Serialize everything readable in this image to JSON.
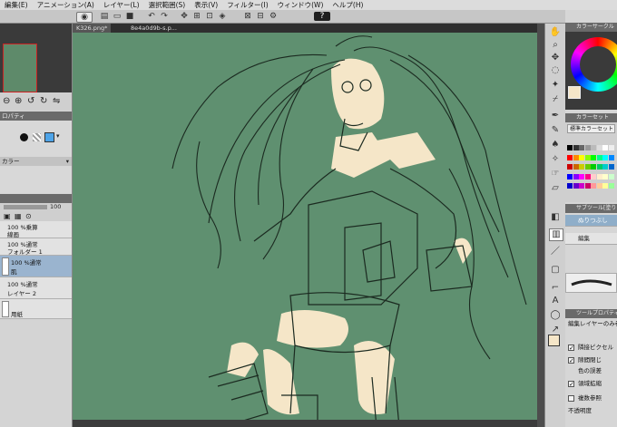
{
  "menu": [
    "編集(E)",
    "アニメーション(A)",
    "レイヤー(L)",
    "選択範囲(S)",
    "表示(V)",
    "フィルター(I)",
    "ウィンドウ(W)",
    "ヘルプ(H)"
  ],
  "doc_tabs": [
    "K326.png*",
    "8e4a0d9b-s.p..."
  ],
  "left": {
    "property_tab": "ロパティ",
    "color_label": "カラー",
    "opacity_value": "100",
    "layers": [
      {
        "label": "100 %乗算",
        "sub": "線画",
        "selected": false
      },
      {
        "label": "100 %通常",
        "sub": "フォルダー 1",
        "selected": false
      },
      {
        "label": "100 %通常",
        "sub": "肌",
        "selected": true
      },
      {
        "label": "100 %通常",
        "sub": "レイヤー 2",
        "selected": false
      },
      {
        "label": "",
        "sub": "用紙",
        "selected": false
      }
    ]
  },
  "right": {
    "color_circle_tab": "カラーサークル",
    "color_set_tab": "カラーセット",
    "standard_color_set": "標準カラーセット",
    "sub_tool_tab": "サブツール[塗り",
    "sub_tools": [
      "ぬりつぶし",
      "編集"
    ],
    "tool_property_tab": "ツールプロパティ",
    "edit_layer_only": "編集レイヤーのみ参",
    "properties": [
      {
        "label": "隣接ピクセル",
        "checked": true
      },
      {
        "label": "隙間閉じ",
        "checked": true
      },
      {
        "label": "色の誤差",
        "checked": false
      },
      {
        "label": "領域拡縮",
        "checked": true
      },
      {
        "label": "複数参照",
        "checked": false
      },
      {
        "label": "不透明度",
        "checked": false
      }
    ]
  },
  "colors": {
    "canvas_bg": "#5f9070",
    "skin": "#f5e6c8",
    "line": "#1b2a20",
    "selected_layer": "#9ab4cf"
  },
  "icons": [
    "hand-icon",
    "zoom-icon",
    "move-icon",
    "lasso-icon",
    "wand-icon",
    "eyedropper-icon",
    "pen-icon",
    "pencil-icon",
    "brush-icon",
    "airbrush-icon",
    "blend-icon",
    "eraser-icon",
    "fill-icon",
    "gradient-icon",
    "line-icon",
    "frame-icon",
    "text-icon",
    "balloon-icon",
    "ruler-icon"
  ]
}
